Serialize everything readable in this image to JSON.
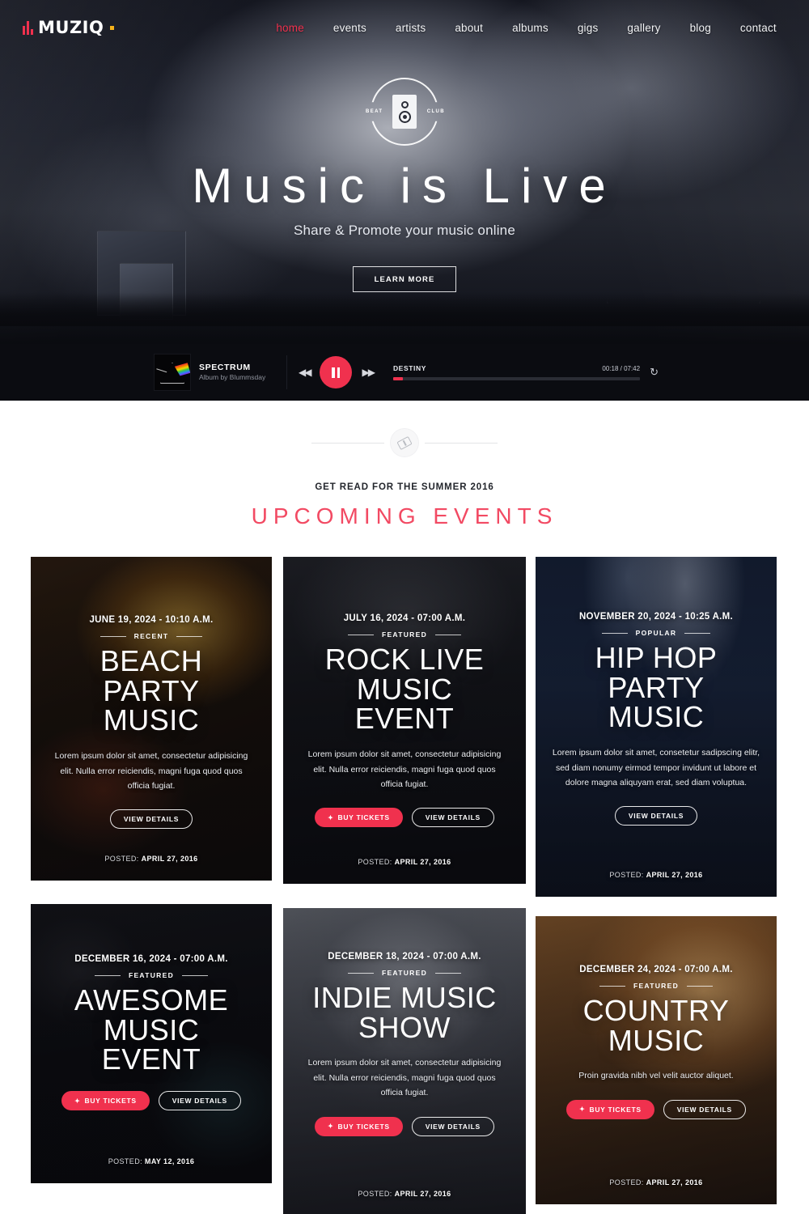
{
  "brand": {
    "name": "MUZIQ",
    "accent": "#f0314e",
    "dot_color": "#f5b21a"
  },
  "nav": {
    "items": [
      {
        "label": "home",
        "active": true
      },
      {
        "label": "events",
        "active": false
      },
      {
        "label": "artists",
        "active": false
      },
      {
        "label": "about",
        "active": false
      },
      {
        "label": "albums",
        "active": false
      },
      {
        "label": "gigs",
        "active": false
      },
      {
        "label": "gallery",
        "active": false
      },
      {
        "label": "blog",
        "active": false
      },
      {
        "label": "contact",
        "active": false
      }
    ]
  },
  "hero": {
    "emblem_left": "BEAT",
    "emblem_right": "CLUB",
    "emblem_icon": "speaker-icon",
    "title": "Music is Live",
    "subtitle": "Share & Promote your music online",
    "cta_label": "LEARN MORE"
  },
  "player": {
    "album_title": "SPECTRUM",
    "album_subtitle": "Album by Blummsday",
    "album_art": "prism-album-art",
    "prev_icon": "rewind-icon",
    "play_icon": "pause-icon",
    "next_icon": "fast-forward-icon",
    "repeat_icon": "repeat-icon",
    "song": "DESTINY",
    "time": "00:18 / 07:42",
    "progress_percent": 4
  },
  "section": {
    "divider_icon": "ticket-icon",
    "kicker": "GET READ FOR THE SUMMER 2016",
    "title": "UPCOMING EVENTS"
  },
  "events": [
    {
      "date": "JUNE 19, 2024 - 10:10 A.M.",
      "tag": "RECENT",
      "title_lines": [
        "BEACH",
        "PARTY",
        "MUSIC"
      ],
      "description": "Lorem ipsum dolor sit amet, consectetur adipisicing elit. Nulla error reiciendis, magni fuga quod quos officia fugiat.",
      "buy_label": "BUY TICKETS",
      "has_buy": false,
      "view_label": "VIEW DETAILS",
      "posted_prefix": "POSTED:",
      "posted_date": "APRIL 27, 2016"
    },
    {
      "date": "JULY 16, 2024 - 07:00 A.M.",
      "tag": "FEATURED",
      "title_lines": [
        "ROCK LIVE",
        "MUSIC",
        "EVENT"
      ],
      "description": "Lorem ipsum dolor sit amet, consectetur adipisicing elit. Nulla error reiciendis, magni fuga quod quos officia fugiat.",
      "buy_label": "BUY TICKETS",
      "has_buy": true,
      "view_label": "VIEW DETAILS",
      "posted_prefix": "POSTED:",
      "posted_date": "APRIL 27, 2016"
    },
    {
      "date": "NOVEMBER 20, 2024 - 10:25 A.M.",
      "tag": "POPULAR",
      "title_lines": [
        "HIP HOP",
        "PARTY",
        "MUSIC"
      ],
      "description": "Lorem ipsum dolor sit amet, consetetur sadipscing elitr, sed diam nonumy eirmod tempor invidunt ut labore et dolore magna aliquyam erat, sed diam voluptua.",
      "buy_label": "BUY TICKETS",
      "has_buy": false,
      "view_label": "VIEW DETAILS",
      "posted_prefix": "POSTED:",
      "posted_date": "APRIL 27, 2016"
    },
    {
      "date": "DECEMBER 16, 2024 - 07:00 A.M.",
      "tag": "FEATURED",
      "title_lines": [
        "AWESOME",
        "MUSIC",
        "EVENT"
      ],
      "description": "",
      "buy_label": "BUY TICKETS",
      "has_buy": true,
      "view_label": "VIEW DETAILS",
      "posted_prefix": "POSTED:",
      "posted_date": "MAY 12, 2016"
    },
    {
      "date": "DECEMBER 18, 2024 - 07:00 A.M.",
      "tag": "FEATURED",
      "title_lines": [
        "INDIE MUSIC",
        "SHOW"
      ],
      "description": "Lorem ipsum dolor sit amet, consectetur adipisicing elit. Nulla error reiciendis, magni fuga quod quos officia fugiat.",
      "buy_label": "BUY TICKETS",
      "has_buy": true,
      "view_label": "VIEW DETAILS",
      "posted_prefix": "POSTED:",
      "posted_date": "APRIL 27, 2016"
    },
    {
      "date": "DECEMBER 24, 2024 - 07:00 A.M.",
      "tag": "FEATURED",
      "title_lines": [
        "COUNTRY",
        "MUSIC"
      ],
      "description": "Proin gravida nibh vel velit auctor aliquet.",
      "buy_label": "BUY TICKETS",
      "has_buy": true,
      "view_label": "VIEW DETAILS",
      "posted_prefix": "POSTED:",
      "posted_date": "APRIL 27, 2016"
    }
  ]
}
